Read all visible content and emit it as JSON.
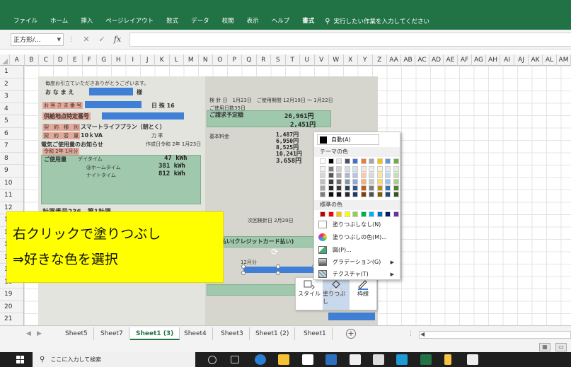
{
  "ribbon": {
    "tabs": [
      "ファイル",
      "ホーム",
      "挿入",
      "ページレイアウト",
      "数式",
      "データ",
      "校閲",
      "表示",
      "ヘルプ",
      "書式"
    ],
    "tellme": "実行したい作業を入力してください"
  },
  "formula": {
    "namebox": "正方形/..."
  },
  "columns": [
    "A",
    "B",
    "C",
    "D",
    "E",
    "F",
    "G",
    "H",
    "I",
    "J",
    "K",
    "L",
    "M",
    "N",
    "O",
    "P",
    "Q",
    "R",
    "S",
    "T",
    "U",
    "V",
    "W",
    "X",
    "Y",
    "Z",
    "AA",
    "AB",
    "AC",
    "AD",
    "AE",
    "AF",
    "AG",
    "AH",
    "AI",
    "AJ",
    "AK",
    "AL",
    "AM"
  ],
  "rows": [
    "1",
    "2",
    "3",
    "4",
    "5",
    "6",
    "7",
    "8",
    "9",
    "10",
    "11",
    "12",
    "13",
    "14",
    "15",
    "16",
    "17",
    "18",
    "19",
    "20",
    "21",
    "22"
  ],
  "receipt": {
    "greeting": "毎度お引立ていただきありがとうございます。",
    "customer_name": "お な ま え",
    "honorific": "様",
    "customer_no_label": "お 客 さ ま 番 号",
    "customer_no_suffix": "日 殊  16",
    "supply_point_label": "供給地点特定番号",
    "contract_type_label": "契　約　種　別",
    "contract_type_value": "スマートライフプラン（朝とく）",
    "contract_amount_label": "契　約　容　量",
    "contract_amount_value": "10ｋVA",
    "contract_amount_unit": "力 率",
    "notice": "電気ご使用量のお知らせ",
    "notice_date": "作成日令和 2年 1月23日",
    "notice_month": "令和 2年 1月分",
    "usage_label": "ご使用量",
    "usage_day_label": "デイタイム",
    "usage_day_value": "47 kWh",
    "usage_home_label": "@ホームタイム",
    "usage_home_value": "381 kWh",
    "usage_night_label": "ナイトタイム",
    "usage_night_value": "812 kWh",
    "meter_label": "計器番号236　第1計器",
    "check_date": "検 針 日　1月23日　ご使用期間 12月19日 ～ 1月22日",
    "days": "ご使用日数35日",
    "bill_label": "ご請求予定額",
    "bill_value": "26,961円",
    "tax_value": "2,451円",
    "rate_label": "基本料金",
    "rate_values": "1,487円\n6,950円\n8,525円\n10,241円",
    "adjust_value": "3,658円",
    "next_check": "次回検針日 2月20日",
    "credit_label": "お支払い(クレジットカード払い)",
    "card_month": "12月分"
  },
  "callout": {
    "line1": "右クリックで塗りつぶし",
    "line2": "⇒好きな色を選択"
  },
  "mini_toolbar": [
    {
      "label": "スタイル"
    },
    {
      "label": "塗りつぶし"
    },
    {
      "label": "枠線"
    }
  ],
  "menu": {
    "auto": "自動(A)",
    "theme_colors_header": "テーマの色",
    "standard_colors_header": "標準の色",
    "no_fill": "塗りつぶしなし(N)",
    "more_colors": "塗りつぶしの色(M)...",
    "picture": "図(P)...",
    "gradient": "グラデーション(G)",
    "texture": "テクスチャ(T)",
    "theme_colors": [
      [
        "#ffffff",
        "#000000",
        "#e7e6e6",
        "#44546a",
        "#4472c4",
        "#ed7d31",
        "#a5a5a5",
        "#ffc000",
        "#5b9bd5",
        "#70ad47"
      ],
      [
        "#f2f2f2",
        "#7f7f7f",
        "#d0cece",
        "#d6dce4",
        "#d9e2f3",
        "#fbe5d5",
        "#ededed",
        "#fff2cc",
        "#deebf6",
        "#e2efd9"
      ],
      [
        "#d8d8d8",
        "#595959",
        "#aeabab",
        "#adb9ca",
        "#b4c6e7",
        "#f7cbac",
        "#dbdbdb",
        "#fee599",
        "#bdd7ee",
        "#c5e0b3"
      ],
      [
        "#bfbfbf",
        "#3f3f3f",
        "#757070",
        "#8496b0",
        "#8eaadb",
        "#f4b183",
        "#c9c9c9",
        "#ffd965",
        "#9cc3e5",
        "#a8d08d"
      ],
      [
        "#a5a5a5",
        "#262626",
        "#3a3838",
        "#323f4f",
        "#2f5496",
        "#c55a11",
        "#7b7b7b",
        "#bf8f00",
        "#2e75b5",
        "#538135"
      ],
      [
        "#7f7f7f",
        "#0c0c0c",
        "#171616",
        "#222a35",
        "#1f3864",
        "#833c0b",
        "#525252",
        "#7f6000",
        "#1e4e79",
        "#375623"
      ]
    ],
    "standard_colors": [
      "#c00000",
      "#ff0000",
      "#ffc000",
      "#ffff00",
      "#92d050",
      "#00b050",
      "#00b0f0",
      "#0070c0",
      "#002060",
      "#7030a0"
    ]
  },
  "sheets": [
    {
      "name": "Sheet5",
      "active": false
    },
    {
      "name": "Sheet7",
      "active": false
    },
    {
      "name": "Sheet1 (3)",
      "active": true
    },
    {
      "name": "Sheet4",
      "active": false
    },
    {
      "name": "Sheet3",
      "active": false
    },
    {
      "name": "Sheet1 (2)",
      "active": false
    },
    {
      "name": "Sheet1",
      "active": false
    }
  ],
  "taskbar": {
    "search_placeholder": "ここに入力して検索"
  },
  "colors": {
    "excel_green": "#217346",
    "highlight_yellow": "#ffff00",
    "mask_blue": "#3f7fd6"
  }
}
